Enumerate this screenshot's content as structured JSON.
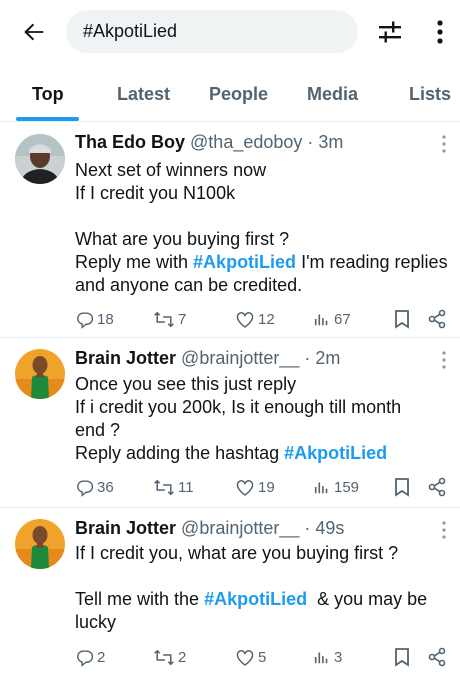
{
  "search": {
    "query": "#AkpotiLied"
  },
  "tabs": [
    {
      "label": "Top"
    },
    {
      "label": "Latest"
    },
    {
      "label": "People"
    },
    {
      "label": "Media"
    },
    {
      "label": "Lists"
    }
  ],
  "tweets": [
    {
      "name": "Tha Edo Boy",
      "handle": "@tha_edoboy",
      "time": "· 3m",
      "lines": [
        "Next set of winners now",
        "If I credit you N100k",
        "",
        "What are you buying first ?",
        [
          "Reply me with ",
          "#AkpotiLied",
          " I'm reading replies"
        ],
        "and anyone can be credited."
      ],
      "replies": "18",
      "reposts": "7",
      "likes": "12",
      "views": "67"
    },
    {
      "name": "Brain Jotter",
      "handle": "@brainjotter__",
      "time": "· 2m",
      "lines": [
        "Once you see this just reply",
        "If i credit you 200k, Is it enough till month",
        "end ?",
        [
          "Reply adding the hashtag ",
          "#AkpotiLied",
          ""
        ]
      ],
      "replies": "36",
      "reposts": "11",
      "likes": "19",
      "views": "159"
    },
    {
      "name": "Brain Jotter",
      "handle": "@brainjotter__",
      "time": "· 49s",
      "lines": [
        "If I credit you, what are you buying first ?",
        "",
        [
          "Tell me with the ",
          "#AkpotiLied",
          "  & you may be"
        ],
        "lucky"
      ],
      "replies": "2",
      "reposts": "2",
      "likes": "5",
      "views": "3"
    }
  ],
  "colors": {
    "accent": "#1d9bf0",
    "text": "#0f1419",
    "muted": "#536471",
    "divider": "#e6ecf0"
  },
  "icons": [
    "back-arrow-icon",
    "filter-sliders-icon",
    "more-vertical-icon",
    "reply-icon",
    "repost-icon",
    "like-icon",
    "views-icon",
    "bookmark-icon",
    "share-icon"
  ]
}
